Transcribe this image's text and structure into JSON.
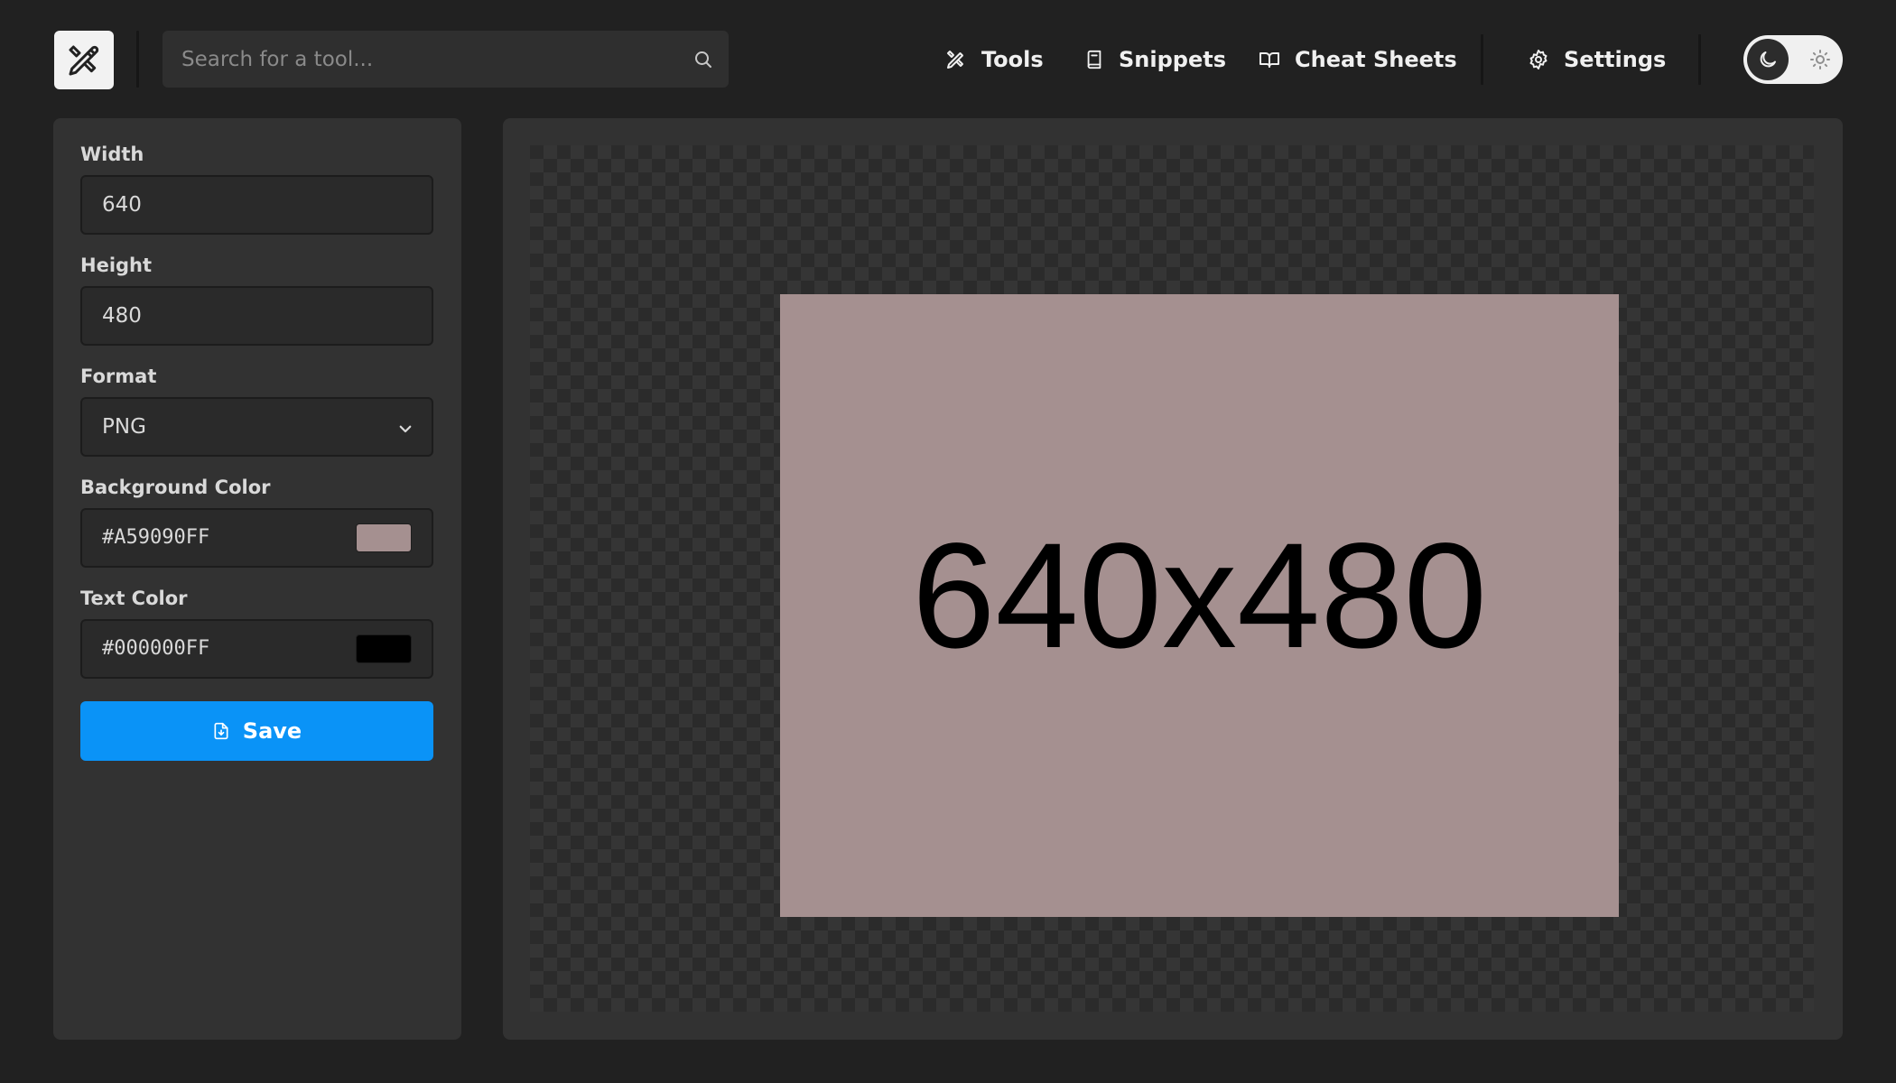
{
  "header": {
    "logo_icon": "tools-icon",
    "search": {
      "placeholder": "Search for a tool...",
      "value": "",
      "icon": "search-icon"
    },
    "nav": [
      {
        "label": "Tools",
        "icon": "tools-icon"
      },
      {
        "label": "Snippets",
        "icon": "book-icon"
      },
      {
        "label": "Cheat Sheets",
        "icon": "open-book-icon"
      },
      {
        "label": "Settings",
        "icon": "gear-icon"
      }
    ],
    "theme_toggle": {
      "mode": "dark",
      "icons": [
        "moon-icon",
        "sun-icon"
      ]
    }
  },
  "sidebar": {
    "width": {
      "label": "Width",
      "value": "640"
    },
    "height": {
      "label": "Height",
      "value": "480"
    },
    "format": {
      "label": "Format",
      "value": "PNG"
    },
    "background_color": {
      "label": "Background Color",
      "value": "#A59090FF",
      "swatch": "#A59090"
    },
    "text_color": {
      "label": "Text Color",
      "value": "#000000FF",
      "swatch": "#000000"
    },
    "save": {
      "label": "Save",
      "icon": "file-download-icon"
    }
  },
  "preview": {
    "text": "640x480",
    "background": "#A59090",
    "text_color": "#000000"
  },
  "colors": {
    "accent": "#0A93F7",
    "page_bg": "#212121",
    "panel_bg": "#323232"
  }
}
